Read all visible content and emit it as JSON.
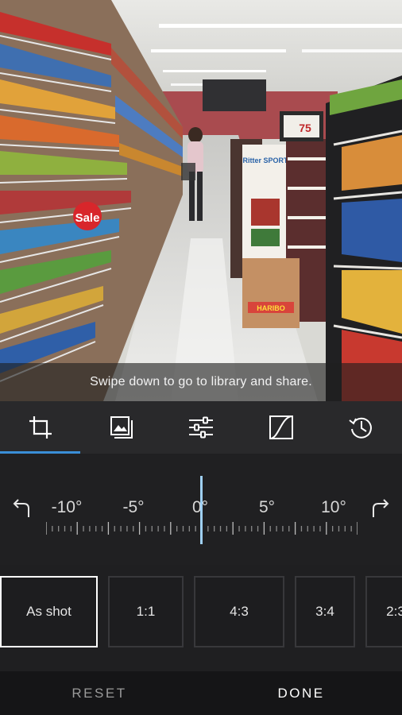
{
  "hint": {
    "text": "Swipe down to go to library and share."
  },
  "photo": {
    "sign_labels": [
      "Sale",
      "75"
    ],
    "product_labels": [
      "Ritter SPORT",
      "HARIBO"
    ]
  },
  "tabs": [
    {
      "name": "crop",
      "icon": "crop-icon",
      "active": true
    },
    {
      "name": "looks",
      "icon": "photo-stack-icon",
      "active": false
    },
    {
      "name": "adjust",
      "icon": "sliders-icon",
      "active": false
    },
    {
      "name": "curves",
      "icon": "curve-icon",
      "active": false
    },
    {
      "name": "history",
      "icon": "history-icon",
      "active": false
    }
  ],
  "dial": {
    "labels": [
      "-10°",
      "-5°",
      "0°",
      "5°",
      "10°"
    ],
    "current_value": 0,
    "rotate_left_icon": "rotate-left-icon",
    "rotate_right_icon": "rotate-right-icon",
    "indicator_color": "#9fd0f5"
  },
  "aspects": [
    {
      "label": "As shot",
      "selected": true
    },
    {
      "label": "1:1",
      "selected": false
    },
    {
      "label": "4:3",
      "selected": false
    },
    {
      "label": "3:4",
      "selected": false
    },
    {
      "label": "2:3",
      "selected": false
    }
  ],
  "actions": {
    "reset": "RESET",
    "done": "DONE"
  },
  "colors": {
    "accent": "#3a8fd8",
    "background": "#1f1f21",
    "selected_border": "#ffffff"
  }
}
